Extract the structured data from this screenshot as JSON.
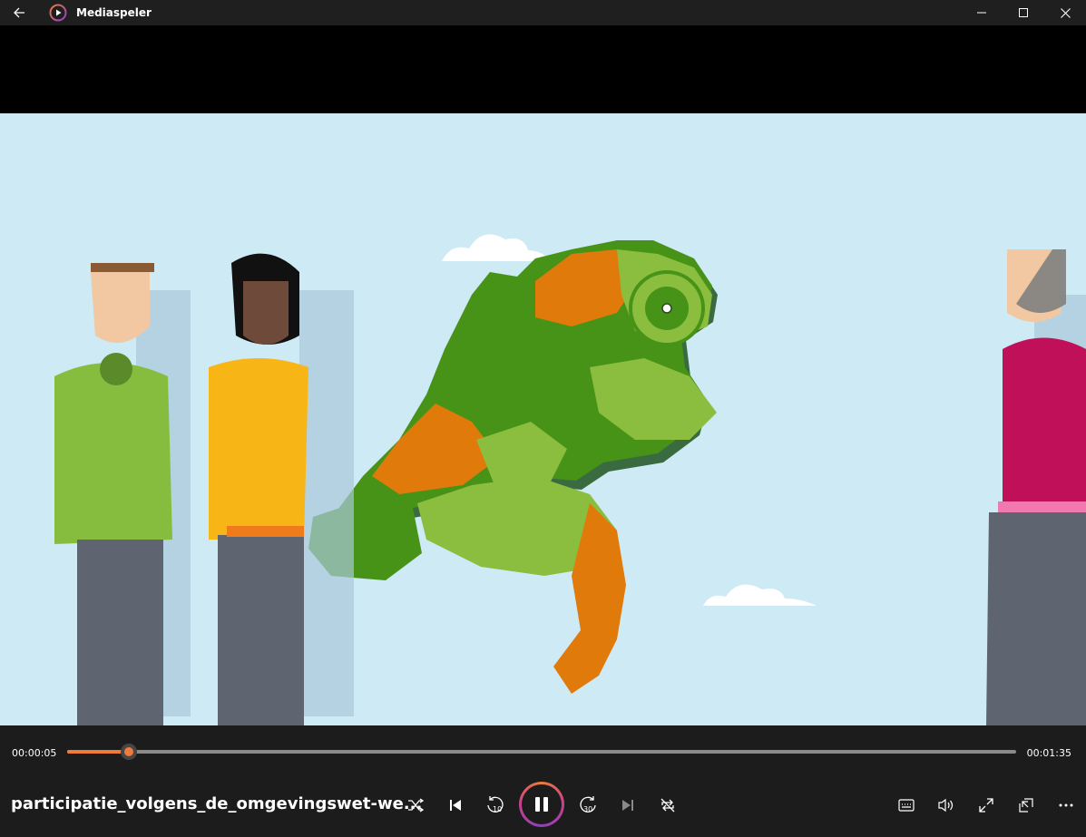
{
  "window": {
    "title": "Mediaspeler",
    "icons": [
      "back-arrow-icon",
      "media-player-icon",
      "minimize-icon",
      "maximize-icon",
      "close-icon"
    ]
  },
  "player": {
    "current_time": "00:00:05",
    "total_time": "00:01:35",
    "progress": 0.065,
    "track_title": "participatie_volgens_de_omgevingswet-we...",
    "accent": "#ef7b3a",
    "controls": [
      "shuffle-icon",
      "previous-icon",
      "rewind-10-icon",
      "pause-icon",
      "forward-30-icon",
      "next-icon",
      "repeat-icon",
      "subtitles-icon",
      "volume-icon",
      "fullscreen-icon",
      "mini-player-icon",
      "more-icon"
    ],
    "rewind_label": "10",
    "forward_label": "30"
  }
}
